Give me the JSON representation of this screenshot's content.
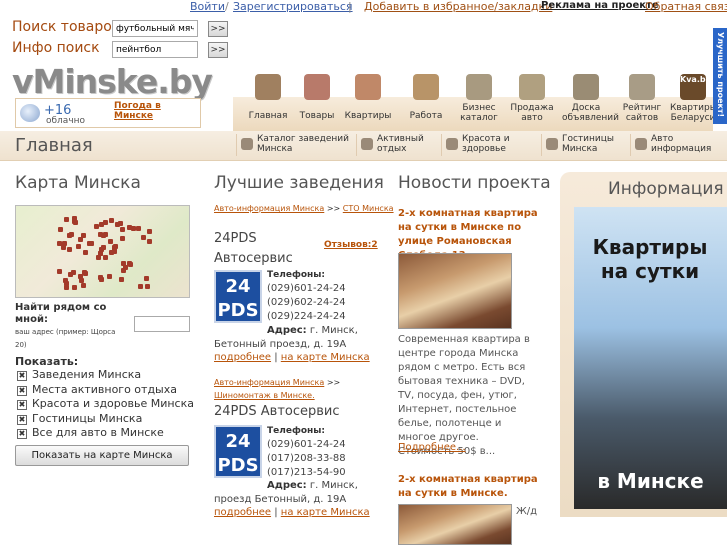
{
  "topbar": {
    "login": "Войти",
    "slash": "/",
    "register": "Зарегистрироваться",
    "divider": "|",
    "favorites": "Добавить в избранное/закладки",
    "advert": "Реклама на проекте",
    "feedback": "Обратная связь"
  },
  "search": {
    "goods_label": "Поиск товаров",
    "goods_value": "футбольный мяч",
    "info_label": "Инфо поиск",
    "info_value": "пейнтбол",
    "go_label": ">>"
  },
  "logo": {
    "text": "vMinske.by"
  },
  "weather": {
    "temp": "+16",
    "desc": "облачно",
    "link": "Погода в Минске"
  },
  "side_tab": {
    "label": "Улучшить проект!"
  },
  "nav": [
    {
      "label": "Главная",
      "icon": "signpost-icon",
      "color": "#a08060"
    },
    {
      "label": "Товары",
      "icon": "shopping-bag-icon",
      "color": "#b87a6a"
    },
    {
      "label": "Квартиры",
      "icon": "house-icon",
      "color": "#c08868"
    },
    {
      "label": "Работа",
      "icon": "briefcase-icon",
      "color": "#b89468"
    },
    {
      "label": "Бизнес каталог",
      "icon": "catalog-icon",
      "color": "#a89a80"
    },
    {
      "label": "Продажа авто",
      "icon": "car-wheel-icon",
      "color": "#b0a080"
    },
    {
      "label": "Доска объявлений",
      "icon": "board-icon",
      "color": "#9a8c74"
    },
    {
      "label": "Рейтинг сайтов",
      "icon": "rating-icon",
      "color": "#a89c86"
    },
    {
      "label": "Квартиры Беларуси",
      "icon": "kva-by-logo-icon",
      "color": "#6a4a2a",
      "badge": "Kva.by"
    }
  ],
  "page_title": "Главная",
  "categories": [
    {
      "label": "Каталог заведений Минска",
      "icon": "catalog-small-icon"
    },
    {
      "label": "Активный отдых",
      "icon": "active-rest-icon"
    },
    {
      "label": "Красота и здоровье",
      "icon": "beauty-icon"
    },
    {
      "label": "Гостиницы Минска",
      "icon": "hotel-icon"
    },
    {
      "label": "Авто информация",
      "icon": "auto-info-icon"
    }
  ],
  "map_section": {
    "heading": "Карта Минска",
    "near_label": "Найти рядом со мной:",
    "address_hint": "ваш адрес (пример: Щорса 20)",
    "address_value": "",
    "show_label": "Показать:",
    "options": [
      "Заведения Минска",
      "Места активного отдыха",
      "Красота и здоровье Минска",
      "Гостиницы Минска",
      "Все для авто в Минске"
    ],
    "button": "Показать на карте Минска"
  },
  "venues": {
    "heading": "Лучшие заведения",
    "items": [
      {
        "crumb_a": "Авто-информация Минска",
        "crumb_sep": ">>",
        "crumb_b": "СТО Минска",
        "title": "24PDS Автосервис",
        "reviews": "Отзывов:2",
        "logo_line1": "24",
        "logo_line2": "PDS",
        "phones_label": "Телефоны:",
        "phones": [
          "(029)601-24-24",
          "(029)602-24-24",
          "(029)224-24-24"
        ],
        "address_label": "Адрес:",
        "address": "г. Минск, Бетонный проезд, д. 19А",
        "more": "подробнее",
        "on_map": "на карте Минска"
      },
      {
        "crumb_a": "Авто-информация Минска",
        "crumb_sep": ">>",
        "crumb_b": "Шиномонтаж в Минске.",
        "title": "24PDS Автосервис",
        "logo_line1": "24",
        "logo_line2": "PDS",
        "phones_label": "Телефоны:",
        "phones": [
          "(029)601-24-24",
          "(017)208-33-88",
          "(017)213-54-90"
        ],
        "address_label": "Адрес:",
        "address": "г. Минск, проезд Бетонный, д. 19А",
        "more": "подробнее",
        "on_map": "на карте Минска"
      }
    ],
    "link_sep": "|"
  },
  "news": {
    "heading": "Новости проекта",
    "items": [
      {
        "title": "2-х комнатная квартира на сутки в Минске по улице Романовская Слобода 13.",
        "text": "Современная квартира в центре города Минска рядом с метро. Есть вся бытовая техника – DVD, TV, посуда, фен, утюг, Интернет, постельное белье, полотенце и многое другое. Стоимость 50$ в...",
        "more": "Подробнее..."
      },
      {
        "title": "2-х комнатная квартира на сутки в Минске.",
        "text": "Ж/д"
      }
    ]
  },
  "info": {
    "heading": "Информация",
    "banner_line1": "Квартиры на сутки",
    "banner_line2": "в Минске"
  }
}
